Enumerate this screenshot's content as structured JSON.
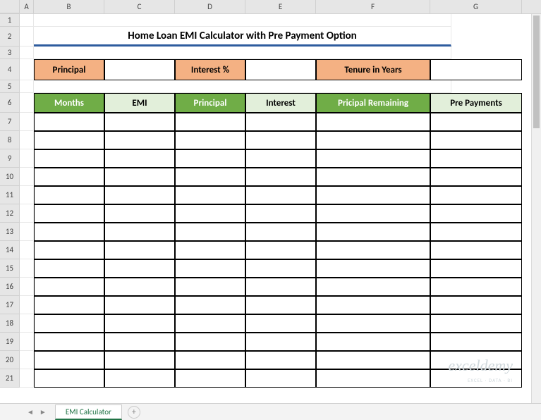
{
  "columns": [
    "A",
    "B",
    "C",
    "D",
    "E",
    "F",
    "G"
  ],
  "row_numbers": [
    1,
    2,
    3,
    4,
    5,
    6,
    7,
    8,
    9,
    10,
    11,
    12,
    13,
    14,
    15,
    16,
    17,
    18,
    19,
    20,
    21
  ],
  "title": "Home Loan EMI Calculator with Pre Payment Option",
  "inputs": {
    "principal_label": "Principal",
    "principal_value": "",
    "interest_label": "Interest %",
    "interest_value": "",
    "tenure_label": "Tenure in Years",
    "tenure_value": ""
  },
  "table_headers": {
    "months": "Months",
    "emi": "EMI",
    "principal": "Principal",
    "interest": "Interest",
    "principal_remaining": "Pricipal Remaining",
    "pre_payments": "Pre Payments"
  },
  "sheet_tab": "EMI Calculator",
  "watermark": {
    "main": "exceldemy",
    "sub": "EXCEL · DATA · BI"
  }
}
